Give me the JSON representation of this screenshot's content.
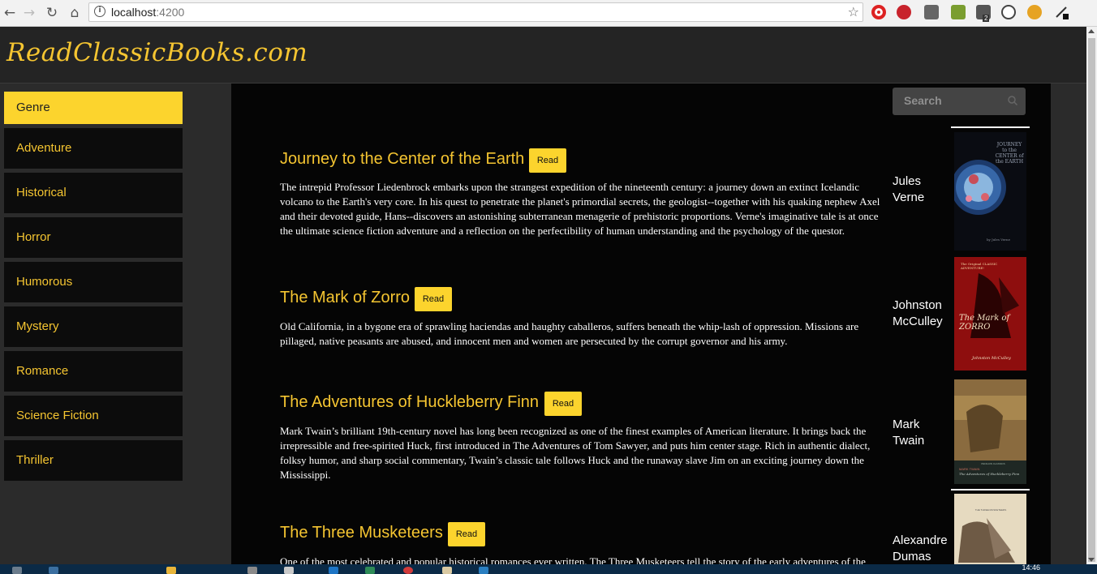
{
  "browser": {
    "url_host": "localhost",
    "url_port": ":4200",
    "back_icon": "arrow-left",
    "forward_icon": "arrow-right",
    "reload_icon": "reload",
    "home_icon": "home",
    "star_icon": "star",
    "extension_badge": "2"
  },
  "site": {
    "logo": "ReadClassicBooks.com"
  },
  "sidebar": {
    "items": [
      {
        "label": "Genre"
      },
      {
        "label": "Adventure"
      },
      {
        "label": "Historical"
      },
      {
        "label": "Horror"
      },
      {
        "label": "Humorous"
      },
      {
        "label": "Mystery"
      },
      {
        "label": "Romance"
      },
      {
        "label": "Science Fiction"
      },
      {
        "label": "Thriller"
      }
    ]
  },
  "search": {
    "placeholder": "Search"
  },
  "books": [
    {
      "title": "Journey to the Center of the Earth",
      "read_label": "Read",
      "description": "The intrepid Professor Liedenbrock embarks upon the strangest expedition of the nineteenth century: a journey down an extinct Icelandic volcano to the Earth's very core. In his quest to penetrate the planet's primordial secrets, the geologist--together with his quaking nephew Axel and their devoted guide, Hans--discovers an astonishing subterranean menagerie of prehistoric proportions. Verne's imaginative tale is at once the ultimate science fiction adventure and a reflection on the perfectibility of human understanding and the psychology of the questor.",
      "author_line1": "Jules",
      "author_line2": "Verne",
      "cover": {
        "top_text": "JOURNEY to the CENTER of the EARTH",
        "bottom_text": "by Jules Verne"
      }
    },
    {
      "title": "The Mark of Zorro",
      "read_label": "Read",
      "description": "Old California, in a bygone era of sprawling haciendas and haughty caballeros, suffers beneath the whip-lash of oppression. Missions are pillaged, native peasants are abused, and innocent men and women are persecuted by the corrupt governor and his army.",
      "author_line1": "Johnston",
      "author_line2": "McCulley",
      "cover": {
        "top_text": "The Original CLASSIC ADVENTURE!",
        "middle_text": "The Mark of ZORRO",
        "bottom_text": "Johnston McCulley"
      }
    },
    {
      "title": "The Adventures of Huckleberry Finn",
      "read_label": "Read",
      "description": "Mark Twain’s brilliant 19th-century novel has long been recognized as one of the finest examples of American literature. It brings back the irrepressible and free-spirited Huck, first introduced in The Adventures of Tom Sawyer, and puts him center stage. Rich in authentic dialect, folksy humor, and sharp social commentary, Twain’s classic tale follows Huck and the runaway slave Jim on an exciting journey down the Mississippi.",
      "author_line1": "Mark",
      "author_line2": "Twain",
      "cover": {
        "top_text": "PENGUIN CLASSICS",
        "middle_text": "MARK TWAIN",
        "bottom_text": "The Adventures of Huckleberry Finn"
      }
    },
    {
      "title": "The Three Musketeers",
      "read_label": "Read",
      "description": "One of the most celebrated and popular historical romances ever written, The Three Musketeers tell the story of the early adventures of the",
      "author_line1": "Alexandre",
      "author_line2": "Dumas",
      "cover": {
        "top_text": "THE THREE MUSKETEERS"
      }
    }
  ],
  "taskbar": {
    "clock": "14:46"
  },
  "colors": {
    "accent": "#fcd42d",
    "title": "#f5c531",
    "background": "#050505"
  }
}
